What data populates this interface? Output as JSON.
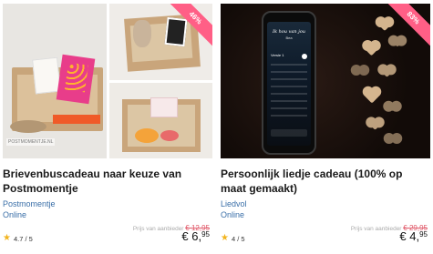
{
  "products": [
    {
      "discount_badge": "46%",
      "watermark": "POSTMOMENTJE.NL",
      "title": "Brievenbuscadeau naar keuze van Postmomentje",
      "vendor": "Postmomentje",
      "location": "Online",
      "old_price_label": "Prijs van aanbieder",
      "old_price": "€ 12,95",
      "rating": "4.7 / 5",
      "price_main": "€ 6,",
      "price_cents": "95"
    },
    {
      "discount_badge": "83%",
      "screen_title": "Ik hou van jou",
      "screen_subtitle": "Bea",
      "screen_verse": "Versie 1",
      "title": "Persoonlijk liedje cadeau (100% op maat gemaakt)",
      "vendor": "Liedvol",
      "location": "Online",
      "old_price_label": "Prijs van aanbieder",
      "old_price": "€ 29,95",
      "rating": "4 / 5",
      "price_main": "€ 4,",
      "price_cents": "95"
    }
  ],
  "colors": {
    "badge": "#ff5f86",
    "link": "#3a6fa8",
    "strike": "#e15a6a",
    "star": "#f2b41e"
  }
}
